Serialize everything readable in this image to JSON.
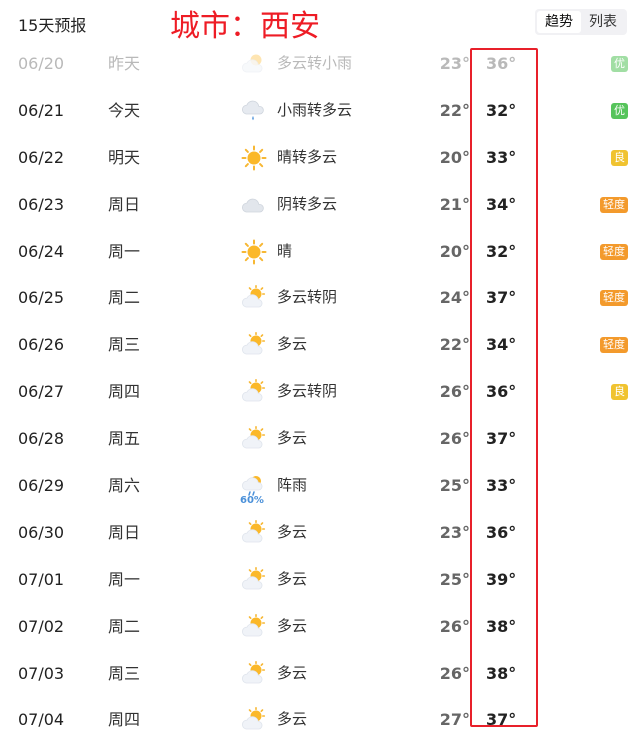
{
  "header": {
    "title": "15天预报",
    "annotation": "城市：西安",
    "tabs": [
      {
        "label": "趋势",
        "active": true
      },
      {
        "label": "列表",
        "active": false
      }
    ]
  },
  "colors": {
    "annotation_red": "#ee1c25",
    "aqi_excellent": "#56c45b",
    "aqi_good": "#f0c330",
    "aqi_light": "#f39a2c"
  },
  "forecast": [
    {
      "date": "06/20",
      "day": "昨天",
      "icon": "cloudy-light-rain-icon",
      "condition": "多云转小雨",
      "low": "23°",
      "high": "36°",
      "aqi": "优",
      "aqi_level": "excellent",
      "past": true
    },
    {
      "date": "06/21",
      "day": "今天",
      "icon": "light-rain-icon",
      "condition": "小雨转多云",
      "low": "22°",
      "high": "32°",
      "aqi": "优",
      "aqi_level": "excellent"
    },
    {
      "date": "06/22",
      "day": "明天",
      "icon": "sunny-icon",
      "condition": "晴转多云",
      "low": "20°",
      "high": "33°",
      "aqi": "良",
      "aqi_level": "good"
    },
    {
      "date": "06/23",
      "day": "周日",
      "icon": "overcast-icon",
      "condition": "阴转多云",
      "low": "21°",
      "high": "34°",
      "aqi": "轻度",
      "aqi_level": "light"
    },
    {
      "date": "06/24",
      "day": "周一",
      "icon": "sunny-icon",
      "condition": "晴",
      "low": "20°",
      "high": "32°",
      "aqi": "轻度",
      "aqi_level": "light"
    },
    {
      "date": "06/25",
      "day": "周二",
      "icon": "partly-cloudy-icon",
      "condition": "多云转阴",
      "low": "24°",
      "high": "37°",
      "aqi": "轻度",
      "aqi_level": "light"
    },
    {
      "date": "06/26",
      "day": "周三",
      "icon": "partly-cloudy-icon",
      "condition": "多云",
      "low": "22°",
      "high": "34°",
      "aqi": "轻度",
      "aqi_level": "light"
    },
    {
      "date": "06/27",
      "day": "周四",
      "icon": "partly-cloudy-icon",
      "condition": "多云转阴",
      "low": "26°",
      "high": "36°",
      "aqi": "良",
      "aqi_level": "good"
    },
    {
      "date": "06/28",
      "day": "周五",
      "icon": "partly-cloudy-icon",
      "condition": "多云",
      "low": "26°",
      "high": "37°",
      "aqi": "",
      "aqi_level": ""
    },
    {
      "date": "06/29",
      "day": "周六",
      "icon": "shower-icon",
      "condition": "阵雨",
      "low": "25°",
      "high": "33°",
      "aqi": "",
      "aqi_level": "",
      "precip": "60%"
    },
    {
      "date": "06/30",
      "day": "周日",
      "icon": "partly-cloudy-icon",
      "condition": "多云",
      "low": "23°",
      "high": "36°",
      "aqi": "",
      "aqi_level": ""
    },
    {
      "date": "07/01",
      "day": "周一",
      "icon": "partly-cloudy-icon",
      "condition": "多云",
      "low": "25°",
      "high": "39°",
      "aqi": "",
      "aqi_level": ""
    },
    {
      "date": "07/02",
      "day": "周二",
      "icon": "partly-cloudy-icon",
      "condition": "多云",
      "low": "26°",
      "high": "38°",
      "aqi": "",
      "aqi_level": ""
    },
    {
      "date": "07/03",
      "day": "周三",
      "icon": "partly-cloudy-icon",
      "condition": "多云",
      "low": "26°",
      "high": "38°",
      "aqi": "",
      "aqi_level": ""
    },
    {
      "date": "07/04",
      "day": "周四",
      "icon": "partly-cloudy-icon",
      "condition": "多云",
      "low": "27°",
      "high": "37°",
      "aqi": "",
      "aqi_level": ""
    }
  ]
}
